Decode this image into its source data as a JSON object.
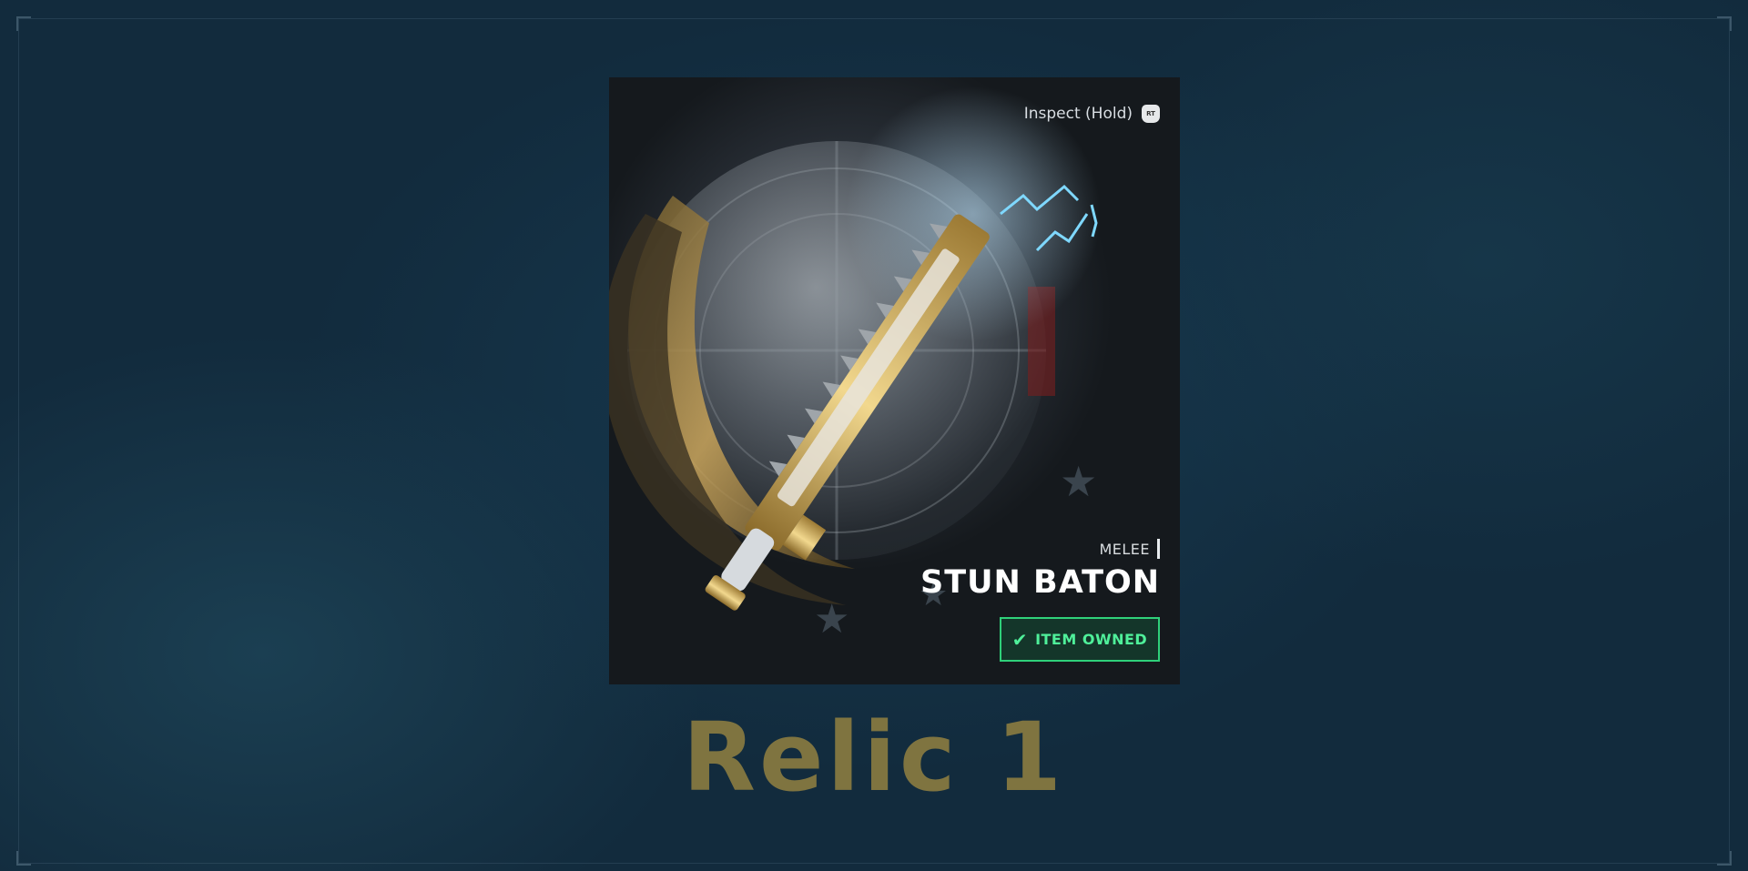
{
  "item_card": {
    "inspect_label": "Inspect (Hold)",
    "inspect_key": "RT",
    "category": "MELEE",
    "name": "STUN BATON",
    "status": "ITEM OWNED"
  },
  "relic_title": "Relic 1",
  "colors": {
    "background": "#122b3d",
    "owned_accent": "#2fd17a",
    "title_gold": "#7f7440"
  },
  "icons": [
    "check-icon",
    "rt-trigger-icon"
  ]
}
